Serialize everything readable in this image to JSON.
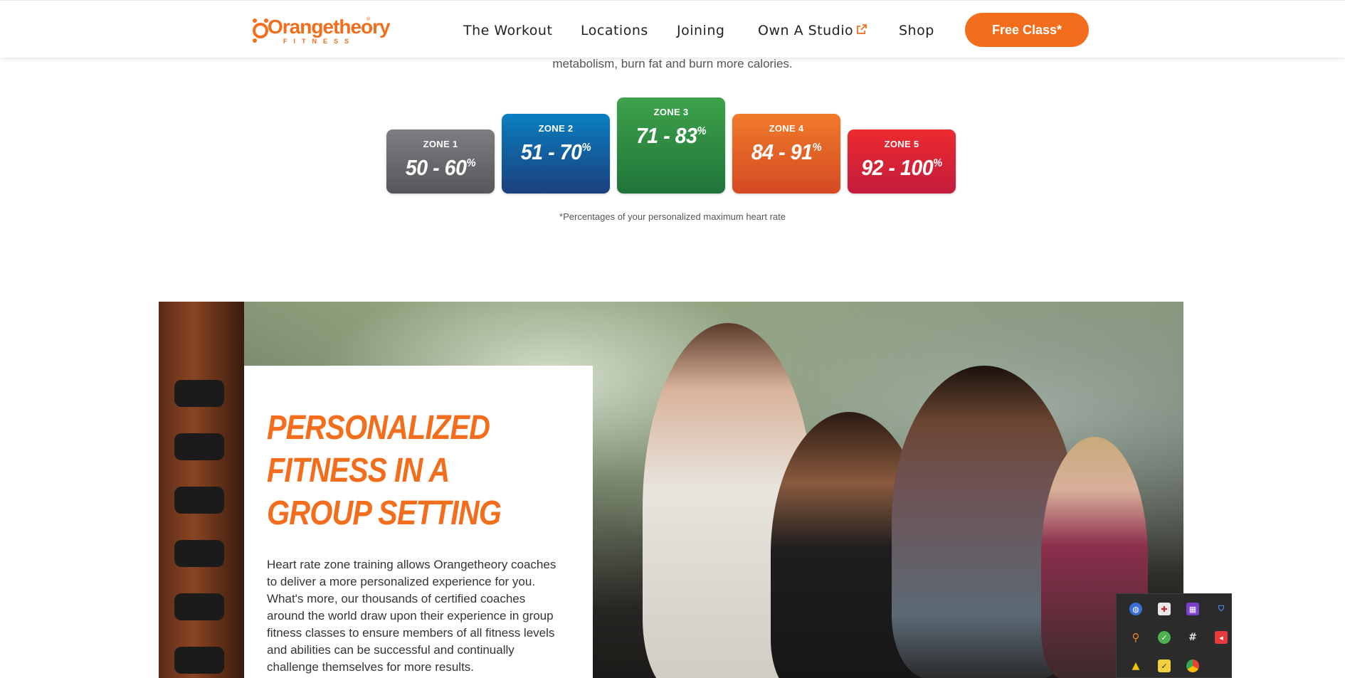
{
  "header": {
    "logo": {
      "wordmark": "Orangetheory",
      "subtitle": "FITNESS",
      "registered": "®"
    },
    "nav": [
      {
        "label": "The Workout"
      },
      {
        "label": "Locations"
      },
      {
        "label": "Joining"
      },
      {
        "label": "Own A Studio",
        "icon": "external-link-icon"
      },
      {
        "label": "Shop"
      }
    ],
    "cta_label": "Free Class*"
  },
  "intro": {
    "text": "metabolism, burn fat and burn more calories."
  },
  "zones": [
    {
      "label": "ZONE 1",
      "range": "50 - 60",
      "unit": "%",
      "color_top": "#7c7e82",
      "color_bottom": "#55575b"
    },
    {
      "label": "ZONE 2",
      "range": "51 - 70",
      "unit": "%",
      "color_top": "#0a7fc0",
      "color_bottom": "#1b3f7d"
    },
    {
      "label": "ZONE 3",
      "range": "71 - 83",
      "unit": "%",
      "color_top": "#3ea24a",
      "color_bottom": "#1f7439"
    },
    {
      "label": "ZONE 4",
      "range": "84 - 91",
      "unit": "%",
      "color_top": "#f07a2a",
      "color_bottom": "#d44a23"
    },
    {
      "label": "ZONE 5",
      "range": "92 - 100",
      "unit": "%",
      "color_top": "#ec2a2f",
      "color_bottom": "#c41d3d"
    }
  ],
  "zone_note": "*Percentages of your personalized maximum heart rate",
  "feature": {
    "title": "PERSONALIZED FITNESS IN A GROUP SETTING",
    "body": "Heart rate zone training allows Orangetheory coaches to deliver a more personalized experience for you. What's more, our thousands of certified coaches around the world draw upon their experience in group fitness classes to ensure members of all fitness levels and abilities can be successful and continually challenge themselves for more results."
  },
  "tray": {
    "icons": [
      {
        "name": "vpn-shield-icon",
        "color": "#3b6fd8"
      },
      {
        "name": "red-cross-shield-icon",
        "color": "#d8d8d8"
      },
      {
        "name": "app-grid-icon",
        "color": "#7b3fd0"
      },
      {
        "name": "defender-shield-icon",
        "color": "#2d7be0"
      },
      {
        "name": "search-magnifier-icon",
        "color": "#f08a1c"
      },
      {
        "name": "security-check-icon",
        "color": "#4caf50"
      },
      {
        "name": "slack-icon",
        "color": "#e0e0e0"
      },
      {
        "name": "media-icon",
        "color": "#e83a3a"
      },
      {
        "name": "google-drive-icon",
        "color": "#f4c20d"
      },
      {
        "name": "sticky-note-icon",
        "color": "#f4d03f"
      },
      {
        "name": "chrome-icon",
        "color": "#4285f4"
      }
    ],
    "brand_orange": "#f26e1d"
  }
}
